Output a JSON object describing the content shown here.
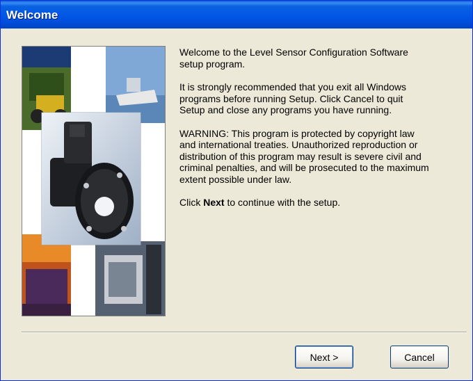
{
  "window": {
    "title": "Welcome"
  },
  "content": {
    "paragraph1": "Welcome to the Level Sensor Configuration Software\n setup program.",
    "paragraph2": "It is strongly recommended that you exit all Windows\n programs before running Setup.  Click Cancel to quit\n Setup and close any programs you have running.",
    "paragraph3": "WARNING: This program is protected by copyright law\n and international treaties.  Unauthorized reproduction or\n distribution of this program may result is severe civil and\n criminal penalties, and will be prosecuted to the maximum\n extent possible under law.",
    "paragraph4_prefix": "Click ",
    "paragraph4_bold": "Next",
    "paragraph4_suffix": " to continue with the setup."
  },
  "buttons": {
    "next_label": "Next >",
    "cancel_label": "Cancel"
  },
  "colors": {
    "titlebar": "#0055e5",
    "dialog_bg": "#ece9d8",
    "button_border": "#003c74"
  }
}
